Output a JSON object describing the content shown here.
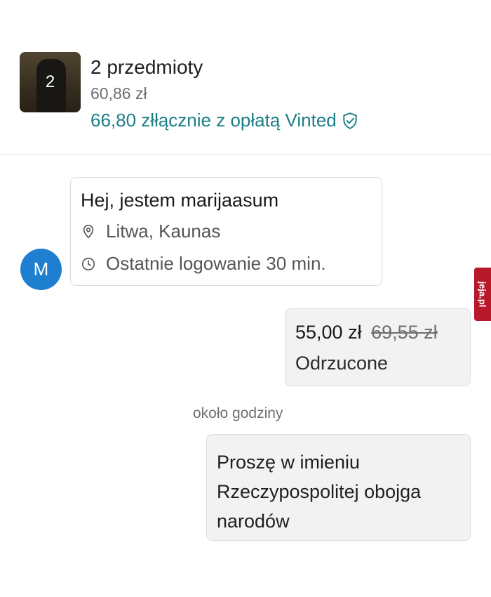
{
  "item_summary": {
    "thumbnail_count": "2",
    "title": "2 przedmioty",
    "price": "60,86 zł",
    "total_with_fee": "66,80 złłącznie z opłatą Vinted",
    "fee_icon": "shield-check-icon",
    "accent_color": "#1c7f86"
  },
  "profile": {
    "avatar_letter": "M",
    "avatar_color": "#1e7fd0",
    "greeting": "Hej, jestem marijaasum",
    "location_icon": "location-pin-icon",
    "location": "Litwa, Kaunas",
    "login_icon": "clock-icon",
    "last_login": "Ostatnie logowanie 30 min."
  },
  "offer": {
    "new_price": "55,00 zł",
    "old_price": "69,55 zł",
    "status": "Odrzucone"
  },
  "timestamp": "około godziny",
  "message": {
    "text": "Proszę w imieniu Rzeczypospolitej obojga narodów"
  },
  "watermark": {
    "text": "jeja.pl"
  }
}
